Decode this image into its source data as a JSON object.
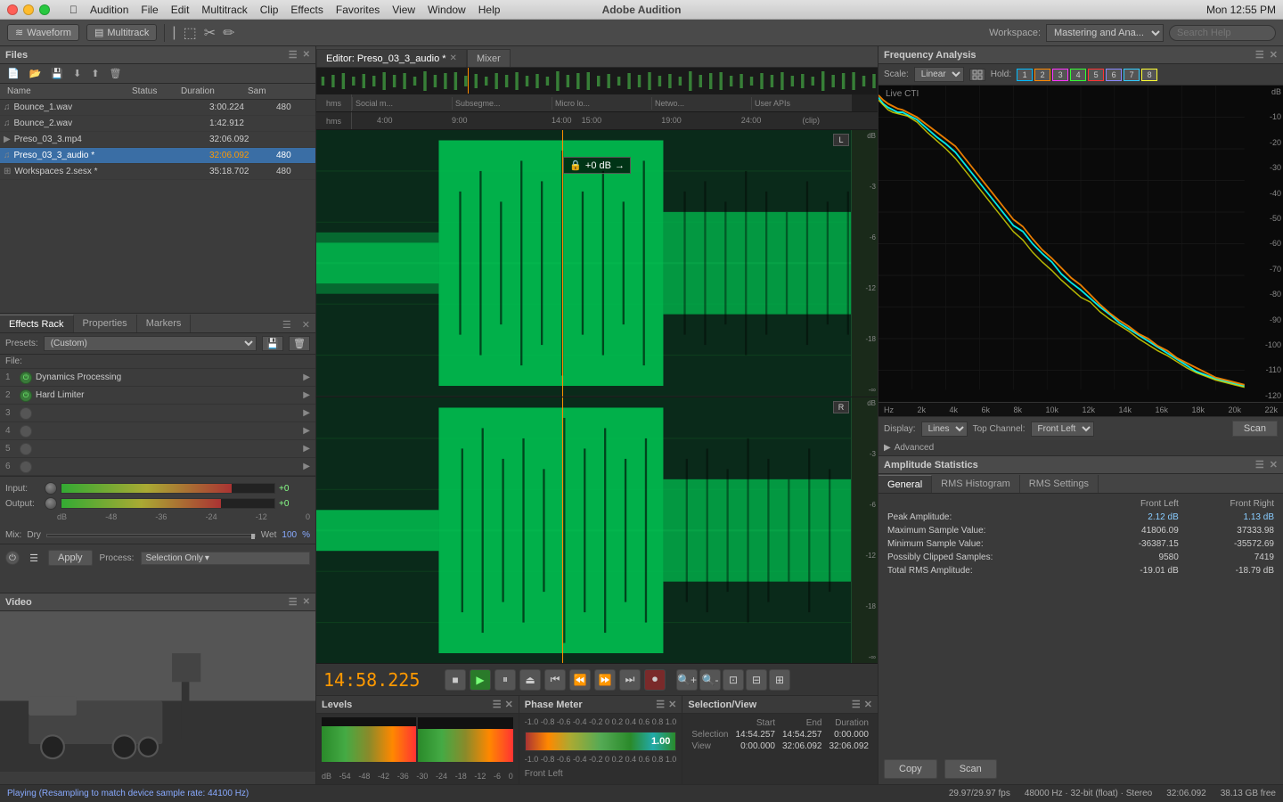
{
  "app": {
    "title": "Adobe Audition",
    "name": "Audition"
  },
  "mac": {
    "menu_items": [
      "Audition",
      "File",
      "Edit",
      "Multitrack",
      "Clip",
      "Effects",
      "Favorites",
      "View",
      "Window",
      "Help"
    ],
    "clock": "Mon 12:55 PM",
    "battery_icon": "14"
  },
  "toolbar": {
    "waveform_label": "Waveform",
    "multitrack_label": "Multitrack",
    "workspace_label": "Workspace:",
    "workspace_value": "Mastering and Ana...",
    "search_placeholder": "Search Help"
  },
  "files_panel": {
    "title": "Files",
    "columns": [
      "Name",
      "Status",
      "Duration",
      "Sam"
    ],
    "files": [
      {
        "icon": "wave",
        "name": "Bounce_1.wav",
        "status": "",
        "duration": "3:00.224",
        "sample": "480"
      },
      {
        "icon": "wave",
        "name": "Bounce_2.wav",
        "status": "",
        "duration": "1:42.912",
        "sample": ""
      },
      {
        "icon": "mp3",
        "name": "Preso_03_3.mp4",
        "status": "",
        "duration": "32:06.092",
        "sample": ""
      },
      {
        "icon": "wave",
        "name": "Preso_03_3_audio *",
        "status": "",
        "duration": "32:06.092",
        "sample": "480",
        "active": true
      },
      {
        "icon": "session",
        "name": "Workspaces 2.sesx *",
        "status": "",
        "duration": "35:18.702",
        "sample": "480"
      }
    ]
  },
  "effects_rack": {
    "title": "Effects Rack",
    "tabs": [
      "Effects Rack",
      "Properties",
      "Markers"
    ],
    "presets_label": "Presets:",
    "presets_value": "(Custom)",
    "file_label": "File:",
    "effects": [
      {
        "num": "1",
        "active": true,
        "name": "Dynamics Processing"
      },
      {
        "num": "2",
        "active": true,
        "name": "Hard Limiter"
      },
      {
        "num": "3",
        "active": false,
        "name": ""
      },
      {
        "num": "4",
        "active": false,
        "name": ""
      },
      {
        "num": "5",
        "active": false,
        "name": ""
      },
      {
        "num": "6",
        "active": false,
        "name": ""
      }
    ],
    "input_label": "Input:",
    "input_value": "+0",
    "output_label": "Output:",
    "output_value": "+0",
    "mix_label": "Mix:",
    "mix_dry": "Dry",
    "mix_wet": "Wet",
    "mix_pct": "100",
    "mix_unit": "%",
    "apply_label": "Apply",
    "process_label": "Process:",
    "selection_only_label": "Selection Only"
  },
  "video_panel": {
    "title": "Video",
    "status": "Playing (Resampling to match device sample rate: 44100 Hz)"
  },
  "editor": {
    "tab_label": "Editor: Preso_03_3_audio *",
    "mixer_label": "Mixer",
    "time_display": "14:58.225",
    "segment_markers": [
      "Social m...",
      "Subsegme...",
      "Micro lo...",
      "Netwo...",
      "User APIs"
    ],
    "time_marks": [
      "4:00",
      "9:00",
      "14:00",
      "15:00",
      "19:00",
      "24:00",
      "(clip)"
    ],
    "playback_position": "14:58.225"
  },
  "frequency_analysis": {
    "title": "Frequency Analysis",
    "scale_label": "Scale:",
    "scale_value": "Linear",
    "hold_label": "Hold:",
    "hold_buttons": [
      "1",
      "2",
      "3",
      "4",
      "5",
      "6",
      "7",
      "8"
    ],
    "live_cti": "Live CTI",
    "hz_labels": [
      "Hz",
      "2k",
      "4k",
      "6k",
      "8k",
      "10k",
      "12k",
      "14k",
      "16k",
      "18k",
      "20k",
      "22k"
    ],
    "db_labels": [
      "dB",
      "-10",
      "-20",
      "-30",
      "-40",
      "-50",
      "-60",
      "-70",
      "-80",
      "-90",
      "-100",
      "-110",
      "-120"
    ],
    "display_label": "Display:",
    "display_value": "Lines",
    "top_channel_label": "Top Channel:",
    "top_channel_value": "Front Left",
    "scan_label": "Scan",
    "advanced_label": "Advanced"
  },
  "amplitude_stats": {
    "title": "Amplitude Statistics",
    "tabs": [
      "General",
      "RMS Histogram",
      "RMS Settings"
    ],
    "columns": [
      "Front Left",
      "Front Right"
    ],
    "rows": [
      {
        "label": "Peak Amplitude:",
        "left": "2.12 dB",
        "right": "1.13 dB"
      },
      {
        "label": "Maximum Sample Value:",
        "left": "41806.09",
        "right": "37333.98"
      },
      {
        "label": "Minimum Sample Value:",
        "left": "-36387.15",
        "right": "-35572.69"
      },
      {
        "label": "Possibly Clipped Samples:",
        "left": "9580",
        "right": "7419"
      },
      {
        "label": "Total RMS Amplitude:",
        "left": "-19.01 dB",
        "right": "-18.79 dB"
      }
    ],
    "copy_label": "Copy",
    "scan_label": "Scan"
  },
  "levels_panel": {
    "title": "Levels",
    "scale": [
      "dB",
      "-54",
      "-48",
      "-42",
      "-36",
      "-30",
      "-24",
      "-18",
      "-12",
      "-6",
      "0"
    ]
  },
  "phase_panel": {
    "title": "Phase Meter",
    "value": "1.00",
    "scale": [
      "-1.0",
      "-0.8",
      "-0.6",
      "-0.4",
      "-0.2",
      "0",
      "0.2",
      "0.4",
      "0.6",
      "0.8",
      "1.0"
    ],
    "channel": "Front Left"
  },
  "selection_view": {
    "title": "Selection/View",
    "columns": [
      "Start",
      "End",
      "Duration"
    ],
    "rows": [
      {
        "label": "Selection",
        "start": "14:54.257",
        "end": "14:54.257",
        "duration": "0:00.000"
      },
      {
        "label": "View",
        "start": "0:00.000",
        "end": "32:06.092",
        "duration": "32:06.092"
      }
    ]
  },
  "status_bar": {
    "playing_text": "Playing (Resampling to match device sample rate: 44100 Hz)",
    "fps": "29.97/29.97 fps",
    "sample_rate": "48000 Hz · 32-bit (float) · Stereo",
    "duration": "32:06.092",
    "disk_free": "38.13 GB free"
  }
}
